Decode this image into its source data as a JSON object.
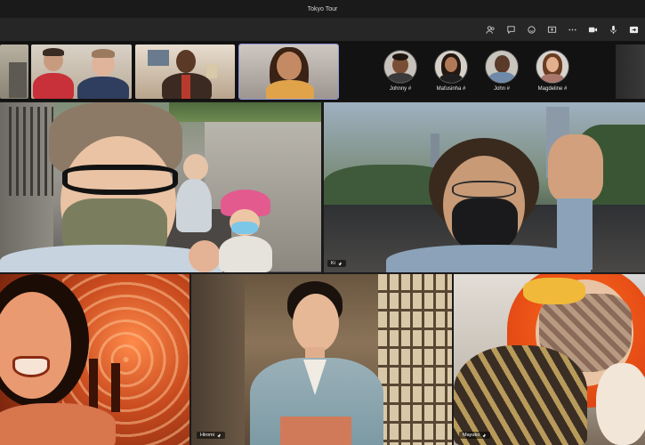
{
  "window": {
    "title": "Tokyo Tour"
  },
  "toolbar": {
    "icons": [
      "people-icon",
      "chat-icon",
      "reactions-icon",
      "share-screen-icon",
      "more-icon",
      "camera-icon",
      "microphone-icon",
      "leave-icon"
    ]
  },
  "strip": {
    "participants": [
      {
        "name": "Johnny",
        "suffix": "#"
      },
      {
        "name": "Mafusinha",
        "suffix": "#"
      },
      {
        "name": "John",
        "suffix": "#"
      },
      {
        "name": "Magdeline",
        "suffix": "#"
      }
    ]
  },
  "tiles": {
    "ki": {
      "name": "Ki"
    },
    "hiromi": {
      "name": "Hiromi"
    },
    "mayuko": {
      "name": "Mayuko"
    }
  },
  "colors": {
    "active_border": "#8f96d8",
    "background": "#1b1b1b",
    "toolbar": "#262626"
  }
}
